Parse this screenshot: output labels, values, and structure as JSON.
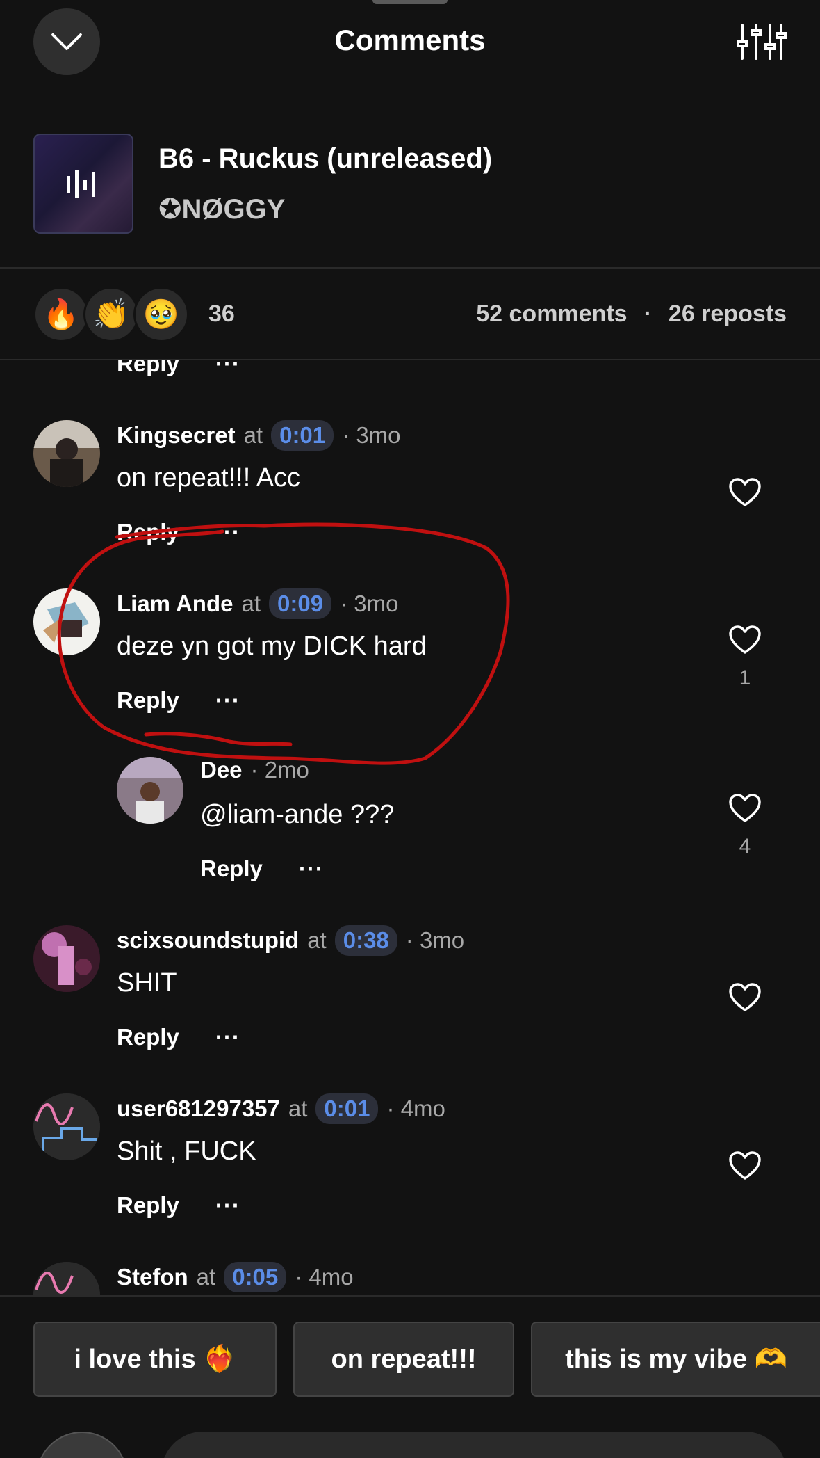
{
  "header": {
    "title": "Comments"
  },
  "track": {
    "title": "B6 - Ruckus (unreleased)",
    "artist": "✪NØGGY"
  },
  "stats": {
    "reactions": [
      "🔥",
      "👏",
      "🥹"
    ],
    "reaction_count": "36",
    "comments_label": "52 comments",
    "separator": "·",
    "reposts_label": "26 reposts"
  },
  "labels": {
    "at": "at",
    "reply": "Reply",
    "more": "···"
  },
  "comments": [
    {
      "user": "Kingsecret",
      "time": "0:01",
      "age": "· 3mo",
      "text": "on repeat!!! Acc",
      "likes": ""
    },
    {
      "user": "Liam Ande",
      "time": "0:09",
      "age": "· 3mo",
      "text": "deze yn got my DICK hard",
      "likes": "1"
    },
    {
      "user": "Dee",
      "time": "",
      "age": "· 2mo",
      "text": "@liam-ande ???",
      "likes": "4"
    },
    {
      "user": "scixsoundstupid",
      "time": "0:38",
      "age": "· 3mo",
      "text": "SHIT",
      "likes": ""
    },
    {
      "user": "user681297357",
      "time": "0:01",
      "age": "· 4mo",
      "text": "Shit , FUCK",
      "likes": ""
    },
    {
      "user": "Stefon",
      "time": "0:05",
      "age": "· 4mo",
      "text": "",
      "likes": ""
    }
  ],
  "quick_replies": [
    "i love this ❤️‍🔥",
    "on repeat!!!",
    "this is my vibe 🫶"
  ],
  "colors": {
    "background": "#121212",
    "timestamp_text": "#5b8de8",
    "annotation_red": "#c01010"
  }
}
